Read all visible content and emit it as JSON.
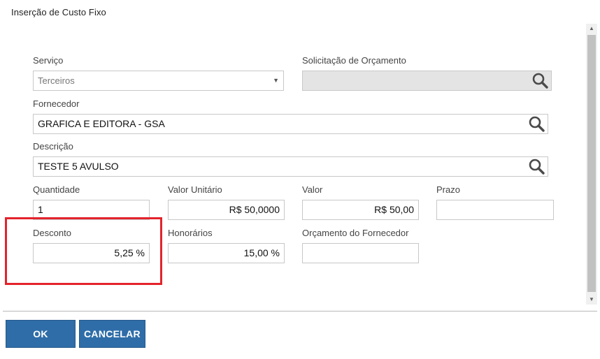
{
  "dialog": {
    "title": "Inserção de Custo Fixo"
  },
  "form": {
    "servico": {
      "label": "Serviço",
      "value": "Terceiros"
    },
    "solicitacao_orcamento": {
      "label": "Solicitação de Orçamento",
      "value": ""
    },
    "fornecedor": {
      "label": "Fornecedor",
      "value": "GRAFICA E EDITORA - GSA"
    },
    "descricao": {
      "label": "Descrição",
      "value": "TESTE 5 AVULSO"
    },
    "quantidade": {
      "label": "Quantidade",
      "value": "1"
    },
    "valor_unitario": {
      "label": "Valor Unitário",
      "value": "R$ 50,0000"
    },
    "valor": {
      "label": "Valor",
      "value": "R$ 50,00"
    },
    "prazo": {
      "label": "Prazo",
      "value": ""
    },
    "desconto": {
      "label": "Desconto",
      "value": "5,25 %"
    },
    "honorarios": {
      "label": "Honorários",
      "value": "15,00 %"
    },
    "orcamento_fornecedor": {
      "label": "Orçamento do Fornecedor",
      "value": ""
    }
  },
  "buttons": {
    "ok": "OK",
    "cancel": "CANCELAR"
  },
  "icons": {
    "search": "search-icon",
    "dropdown": "chevron-down-icon"
  },
  "colors": {
    "button_bg": "#2e6da8",
    "highlight": "#e4232c",
    "disabled_bg": "#e4e4e4"
  }
}
